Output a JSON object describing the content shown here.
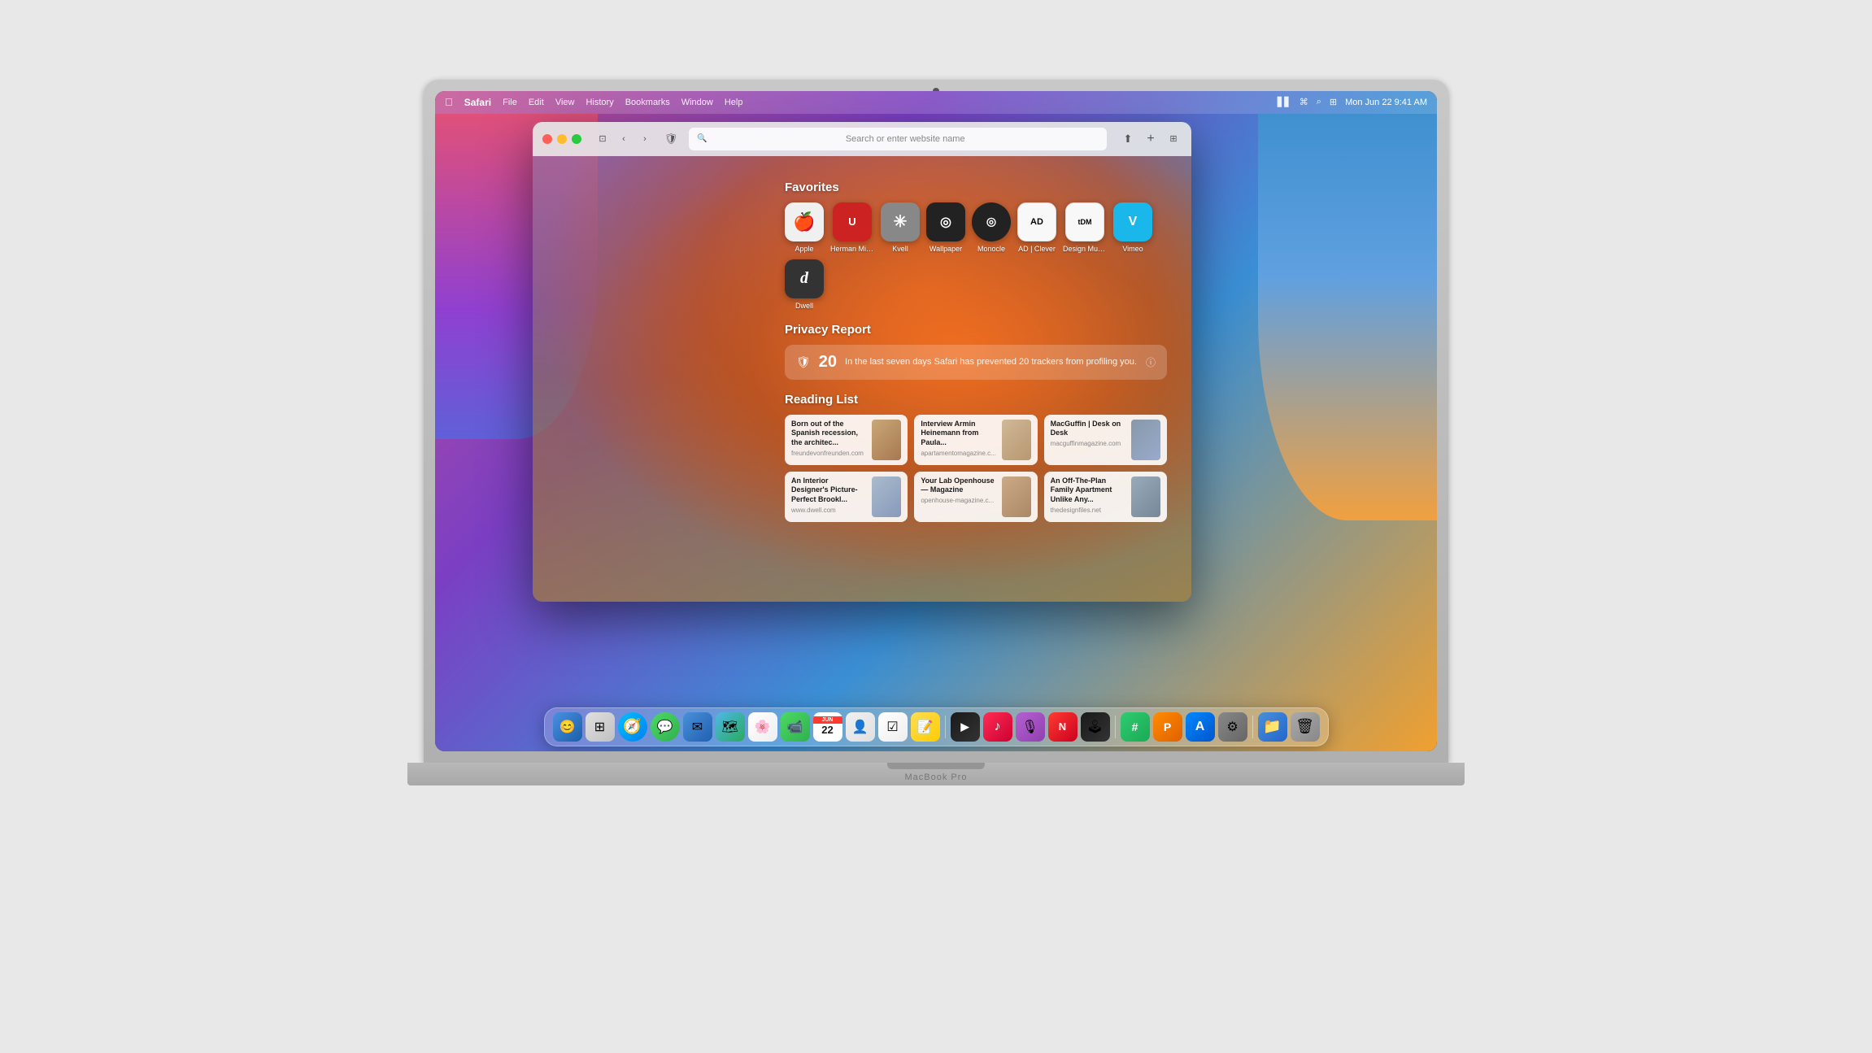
{
  "macbook": {
    "model_label": "MacBook Pro"
  },
  "menubar": {
    "app_name": "Safari",
    "menu_items": [
      "File",
      "Edit",
      "View",
      "History",
      "Bookmarks",
      "Window",
      "Help"
    ],
    "clock": "Mon Jun 22  9:41 AM"
  },
  "safari": {
    "addressbar_placeholder": "Search or enter website name",
    "favorites_title": "Favorites",
    "privacy_title": "Privacy Report",
    "reading_title": "Reading List",
    "privacy_count": "20",
    "privacy_message": "In the last seven days Safari has prevented 20 trackers from profiling you.",
    "favorites": [
      {
        "label": "Apple",
        "symbol": "🍎",
        "color_class": "fav-apple"
      },
      {
        "label": "Herman Miller",
        "symbol": "U",
        "color_class": "fav-herman"
      },
      {
        "label": "Kvell",
        "symbol": "✳",
        "color_class": "fav-kvell"
      },
      {
        "label": "Wallpaper",
        "symbol": "◎",
        "color_class": "fav-wallpaper"
      },
      {
        "label": "Monocle",
        "symbol": "◎",
        "color_class": "fav-monocle"
      },
      {
        "label": "AD | Clever",
        "symbol": "AD",
        "color_class": "fav-ad"
      },
      {
        "label": "Design Museum",
        "symbol": "tDM",
        "color_class": "fav-tdm"
      },
      {
        "label": "Vimeo",
        "symbol": "V",
        "color_class": "fav-vimeo"
      },
      {
        "label": "Dwell",
        "symbol": "d",
        "color_class": "fav-dwell"
      }
    ],
    "reading_items": [
      {
        "title": "Born out of the Spanish recession, the architec...",
        "url": "freundevonfreunden.com",
        "thumb_class": "thumb-1"
      },
      {
        "title": "Interview Armin Heinemann from Paula...",
        "url": "apartamentomagazine.c...",
        "thumb_class": "thumb-2"
      },
      {
        "title": "MacGuffin | Desk on Desk",
        "url": "macguffinmagazine.com",
        "thumb_class": "thumb-3"
      },
      {
        "title": "An Interior Designer's Picture-Perfect Brookl...",
        "url": "www.dwell.com",
        "thumb_class": "thumb-4"
      },
      {
        "title": "Your Lab Openhouse — Magazine",
        "url": "openhouse-magazine.c...",
        "thumb_class": "thumb-5"
      },
      {
        "title": "An Off-The-Plan Family Apartment Unlike Any...",
        "url": "thedesignfiles.net",
        "thumb_class": "thumb-6"
      }
    ]
  },
  "dock": {
    "items": [
      {
        "name": "Finder",
        "emoji": "🔍",
        "bg": "#3a7bd5"
      },
      {
        "name": "Launchpad",
        "emoji": "⚙",
        "bg": "#e8e8e8"
      },
      {
        "name": "Safari",
        "emoji": "🧭",
        "bg": "#00c0ff"
      },
      {
        "name": "Messages",
        "emoji": "💬",
        "bg": "#4cd964"
      },
      {
        "name": "Mail",
        "emoji": "✉",
        "bg": "#4a90d9"
      },
      {
        "name": "Maps",
        "emoji": "🗺",
        "bg": "#34aadc"
      },
      {
        "name": "Photos",
        "emoji": "🌸",
        "bg": "#e8e8e8"
      },
      {
        "name": "FaceTime",
        "emoji": "📹",
        "bg": "#4cd964"
      },
      {
        "name": "Calendar",
        "emoji": "📅",
        "bg": "#ff3b30"
      },
      {
        "name": "Contacts",
        "emoji": "👤",
        "bg": "#e8e8e8"
      },
      {
        "name": "Reminders",
        "emoji": "☑",
        "bg": "#ff9500"
      },
      {
        "name": "Notes",
        "emoji": "📝",
        "bg": "#ffcc00"
      },
      {
        "name": "TV",
        "emoji": "▶",
        "bg": "#1a1a1a"
      },
      {
        "name": "Music",
        "emoji": "♪",
        "bg": "#ff2d55"
      },
      {
        "name": "Podcasts",
        "emoji": "🎙",
        "bg": "#b560d0"
      },
      {
        "name": "News",
        "emoji": "N",
        "bg": "#ff3b30"
      },
      {
        "name": "Arcade",
        "emoji": "🕹",
        "bg": "#1a1a1a"
      },
      {
        "name": "Numbers",
        "emoji": "#",
        "bg": "#2ecc71"
      },
      {
        "name": "Pages",
        "emoji": "P",
        "bg": "#ff8c00"
      },
      {
        "name": "App Store",
        "emoji": "A",
        "bg": "#0077ff"
      },
      {
        "name": "System Preferences",
        "emoji": "⚙",
        "bg": "#888888"
      },
      {
        "name": "Files",
        "emoji": "📁",
        "bg": "#4a90d9"
      },
      {
        "name": "Trash",
        "emoji": "🗑",
        "bg": "#8a8a8a"
      }
    ]
  }
}
